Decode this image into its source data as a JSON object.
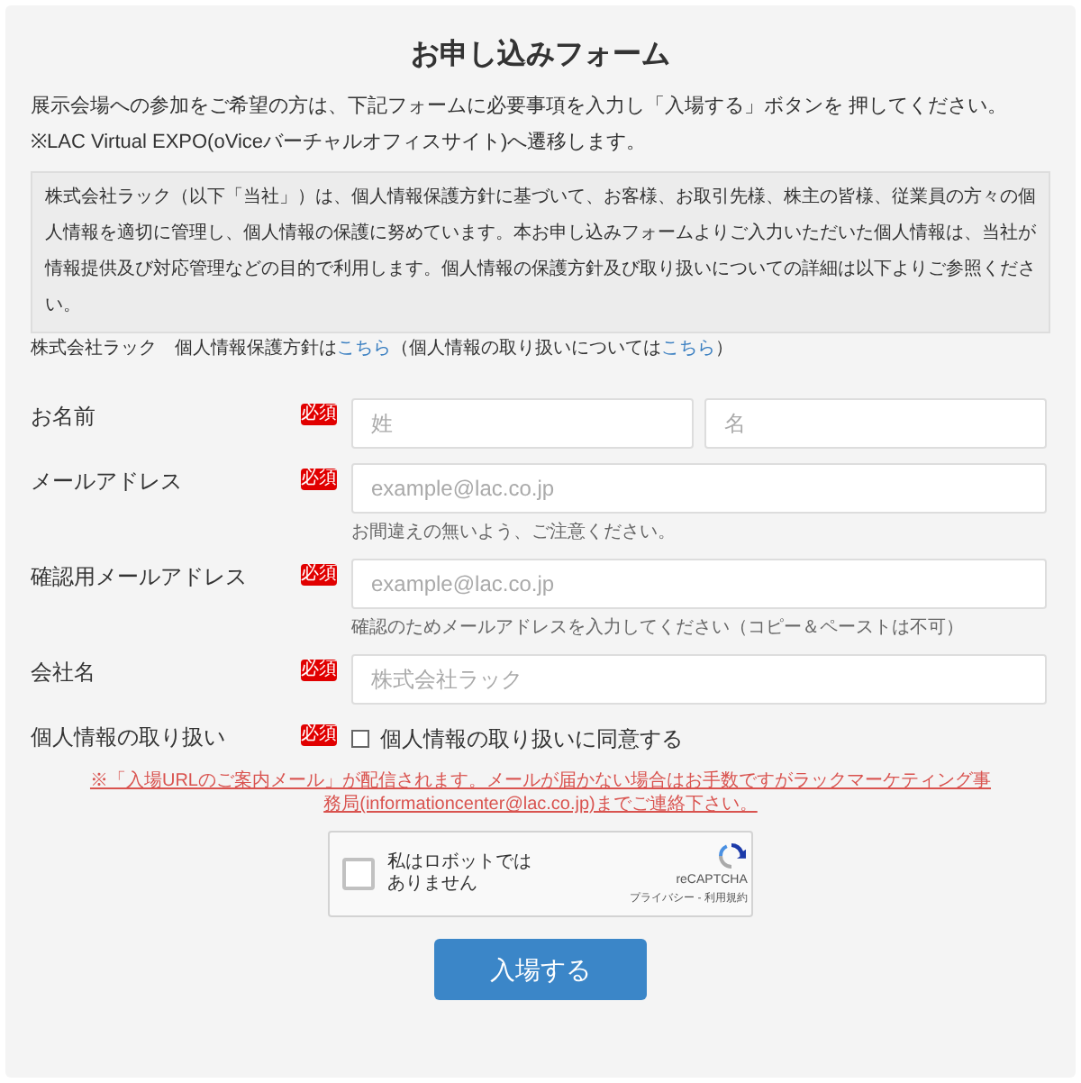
{
  "title": "お申し込みフォーム",
  "intro": [
    "展示会場への参加をご希望の方は、下記フォームに必要事項を入力し「入場する」ボタンを 押してください。",
    "※LAC Virtual EXPO(oViceバーチャルオフィスサイト)へ遷移します。"
  ],
  "privacy_notice": "株式会社ラック（以下「当社」）は、個人情報保護方針に基づいて、お客様、お取引先様、株主の皆様、従業員の方々の個人情報を適切に管理し、個人情報の保護に努めています。本お申し込みフォームよりご入力いただいた個人情報は、当社が情報提供及び対応管理などの目的で利用します。個人情報の保護方針及び取り扱いについての詳細は以下よりご参照ください。",
  "policy_line": {
    "prefix": "株式会社ラック　個人情報保護方針は",
    "link_1": "こちら",
    "middle": "（個人情報の取り扱いについては",
    "link_2": "こちら",
    "suffix": "）"
  },
  "fields": [
    {
      "kind": "name",
      "label": "お名前",
      "badge": "必須",
      "placeholders": [
        "姓",
        "名"
      ]
    },
    {
      "kind": "input",
      "label": "メールアドレス",
      "badge": "必須",
      "placeholder": "example@lac.co.jp",
      "hint": "お間違えの無いよう、ご注意ください。"
    },
    {
      "kind": "input",
      "label": "確認用メールアドレス",
      "badge": "必須",
      "placeholder": "example@lac.co.jp",
      "hint": "確認のためメールアドレスを入力してください（コピー＆ペーストは不可）"
    },
    {
      "kind": "input",
      "label": "会社名",
      "badge": "必須",
      "placeholder": "株式会社ラック"
    },
    {
      "kind": "checkbox",
      "label": "個人情報の取り扱い",
      "badge": "必須",
      "option": "個人情報の取り扱いに同意する",
      "checked": false
    }
  ],
  "notice": "※「入場URLのご案内メール」が配信されます。メールが届かない場合はお手数ですがラックマーケティング事務局(informationcenter@lac.co.jp)までご連絡下さい。",
  "captcha": {
    "label": "私はロボットではありません",
    "brand": "reCAPTCHA",
    "terms": "プライバシー - 利用規約",
    "checked": false
  },
  "submit": "入場する"
}
